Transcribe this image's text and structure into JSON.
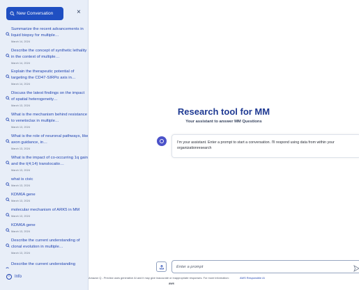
{
  "sidebar": {
    "new_conversation_label": "New Conversation",
    "close_glyph": "×",
    "info_label": "Info",
    "conversations": [
      {
        "title": "Summarize the recent advancements in liquid biopsy for multiple…",
        "date": "March 14, 2024"
      },
      {
        "title": "Describe the concept of synthetic lethality in the context of multiple…",
        "date": "March 14, 2024"
      },
      {
        "title": "Explain the therapeutic potential of targeting the CD47-SIRPα axis in…",
        "date": "March 14, 2024"
      },
      {
        "title": "Discuss the latest findings on the impact of spatial heterogeneity…",
        "date": "March 13, 2024"
      },
      {
        "title": "What is the mechanism behind resistance to venetoclax in multiple…",
        "date": "March 13, 2024"
      },
      {
        "title": "What is the role of neuronal pathways, like axon guidance, in…",
        "date": "March 13, 2024"
      },
      {
        "title": "What is the impact of co-occurring 1q gain and the t(4;14) translocatio…",
        "date": "March 13, 2024"
      },
      {
        "title": "what is civic",
        "date": "March 13, 2024"
      },
      {
        "title": "KDM6A gene",
        "date": "March 13, 2024"
      },
      {
        "title": "molecular mechanism of ARK5 in MM",
        "date": "March 13, 2024"
      },
      {
        "title": "KDM6A gene",
        "date": "March 13, 2024"
      },
      {
        "title": "Describe the current understanding of clonal evolution in multiple…",
        "date": "March 13, 2024"
      },
      {
        "title": "Describe the current understanding",
        "date": ""
      }
    ]
  },
  "main": {
    "title": "Research tool for MM",
    "subtitle": "Your assistant to answer MM Questions",
    "assistant_message": "I'm your assistant. Enter a prompt to start a conversation. I'll respond using data from within your organizationresearch",
    "prompt_placeholder": "Enter a prompt",
    "disclaimer": "Amazon Q - Preview uses generative AI and it may give inaccurate or inappropriate responses. For more information:",
    "responsible_ai_link": "AWS Responsible AI",
    "logo_text": "aws"
  },
  "colors": {
    "accent": "#1f4fc2",
    "sidebar_bg": "#e8eef8",
    "title": "#1f3a93",
    "avatar": "#4b52c9"
  },
  "icons": [
    "search-icon",
    "close-icon",
    "info-icon",
    "upload-icon",
    "send-icon",
    "assistant-avatar-icon"
  ]
}
